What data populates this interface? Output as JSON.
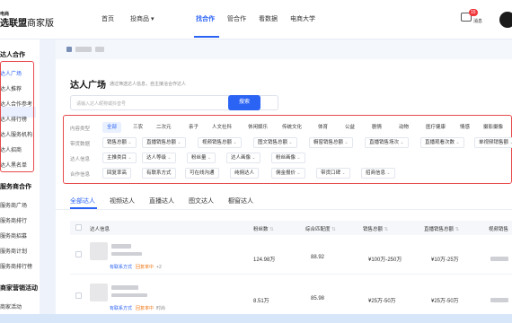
{
  "brand": {
    "tiny": "电商",
    "main": "选联盟",
    "sub": "商家版"
  },
  "topnav": {
    "items": [
      {
        "label": "首页"
      },
      {
        "label": "投商品 ▾"
      },
      {
        "label": "找合作"
      },
      {
        "label": "管合作"
      },
      {
        "label": "看数据"
      },
      {
        "label": "电商大学"
      }
    ],
    "message_label": "消息",
    "message_badge": "15"
  },
  "sidebar": {
    "group1": "达人合作",
    "group1_items": [
      "达人广场",
      "达人推荐",
      "达人合作参考",
      "达人排行榜",
      "达人服务机构",
      "达人招商",
      "达人黑名单"
    ],
    "group2": "服务商合作",
    "group2_items": [
      "服务商广场",
      "服务商排行",
      "服务商招募",
      "服务商计划",
      "服务商排行榜"
    ],
    "group3": "商家营销活动",
    "group3_items": [
      "商家活动"
    ]
  },
  "page": {
    "title": "达人广场",
    "subtitle": "通过筛选达人信息，自主接洽合作达人",
    "search_placeholder": "请输入达人昵称或抖音号",
    "search_button": "搜索"
  },
  "filters": {
    "content_label": "内容类型",
    "content_chips": [
      "全部",
      "三农",
      "二次元",
      "亲子",
      "人文社科",
      "休闲娱乐",
      "传统文化",
      "体育",
      "公益",
      "剧情",
      "动物",
      "医疗健康",
      "情感",
      "摄影摄像"
    ],
    "bg_label": "带货数据",
    "bg_chips": [
      "销售总额",
      "直播销售总额",
      "视频销售总额",
      "图文销售总额",
      "橱窗销售总额",
      "直播销售场次",
      "直播观看次数",
      "单视频销售额"
    ],
    "info_label": "达人信息",
    "info_chips": [
      "主推类目",
      "达人等级",
      "粉丝量",
      "达人画像",
      "粉丝画像"
    ],
    "coop_label": "合作信息",
    "coop_chips": [
      "回复率高",
      "有联系方式",
      "可在线沟通",
      "纯佣达人",
      "佣金报价",
      "带货口碑",
      "招商信息"
    ]
  },
  "tabs": [
    "全部达人",
    "视频达人",
    "直播达人",
    "图文达人",
    "橱窗达人"
  ],
  "table": {
    "headers": [
      "达人信息",
      "粉丝数",
      "综合匹配度",
      "销售总额",
      "直播销售总额",
      "视频销售"
    ],
    "rows": [
      {
        "followers": "124.98万",
        "match": "88.92",
        "sales": "¥100万-250万",
        "live_sales": "¥10万-25万",
        "link1": "有联系方式",
        "link2": "回复率中",
        "link3": "+2"
      },
      {
        "followers": "8.51万",
        "match": "85.98",
        "sales": "¥25万-50万",
        "live_sales": "¥25万-50万",
        "link1": "有联系方式",
        "link2": "回复率中",
        "link3": "时尚"
      }
    ]
  },
  "colors": {
    "accent": "#2b63f5",
    "highlight": "#e84a4a"
  }
}
